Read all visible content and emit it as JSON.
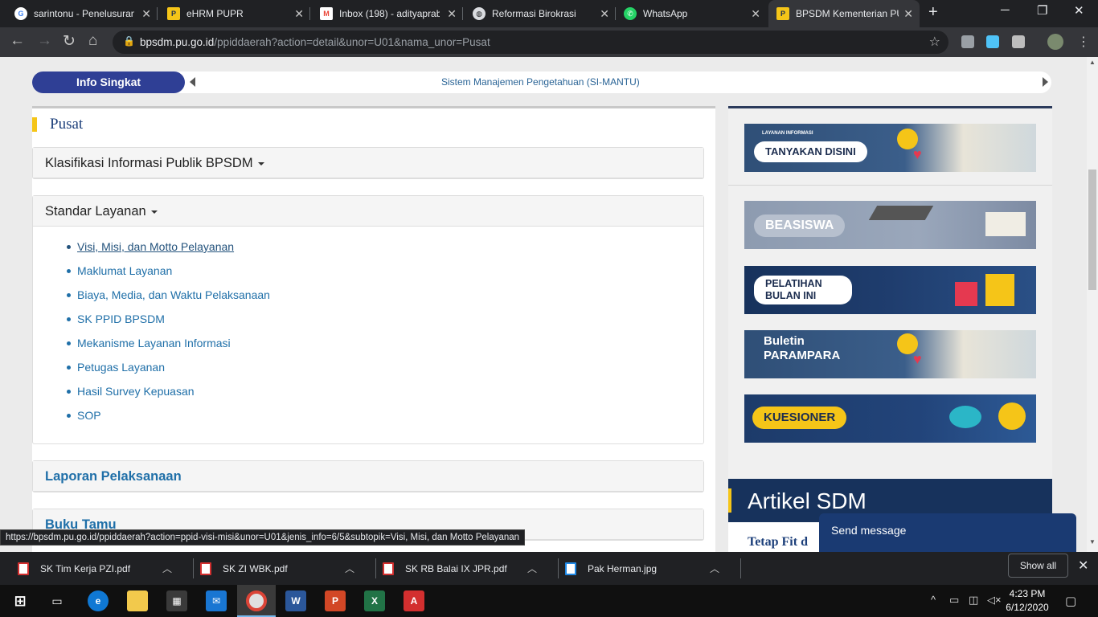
{
  "browser": {
    "tabs": [
      {
        "title": "sarintonu - Penelusuran",
        "favicon": "google-icon",
        "color": "#ffffff"
      },
      {
        "title": "eHRM PUPR",
        "favicon": "pupr-icon",
        "color": "#f5c518"
      },
      {
        "title": "Inbox (198) - adityaprab",
        "favicon": "gmail-icon",
        "color": "#ea4335"
      },
      {
        "title": "Reformasi Birokrasi",
        "favicon": "globe-icon",
        "color": "#dadce0"
      },
      {
        "title": "WhatsApp",
        "favicon": "whatsapp-icon",
        "color": "#25d366"
      },
      {
        "title": "BPSDM Kementerian PU",
        "favicon": "pupr-icon",
        "color": "#f5c518"
      }
    ],
    "url_host": "bpsdm.pu.go.id",
    "url_path": "/ppiddaerah?action=detail&unor=U01&nama_unor=Pusat"
  },
  "ticker": {
    "badge": "Info Singkat",
    "text": "Sistem Manajemen Pengetahuan (SI-MANTU)"
  },
  "main": {
    "section_title": "Pusat",
    "panels": {
      "klasifikasi": "Klasifikasi Informasi Publik BPSDM",
      "standar": "Standar Layanan",
      "standar_items": [
        "Visi, Misi, dan Motto Pelayanan",
        "Maklumat Layanan",
        "Biaya, Media, dan Waktu Pelaksanaan",
        "SK PPID BPSDM",
        "Mekanisme Layanan Informasi",
        "Petugas Layanan",
        "Hasil Survey Kepuasan",
        "SOP"
      ],
      "laporan": "Laporan Pelaksanaan",
      "bukutamu": "Buku Tamu"
    }
  },
  "sidebar": {
    "banners": [
      {
        "small": "LAYANAN INFORMASI",
        "label": "TANYAKAN DISINI",
        "bg": "#2f4f77",
        "pill_bg": "#ffffff",
        "pill_fg": "#1c2d4f"
      },
      {
        "small": "",
        "label": "BEASISWA",
        "bg": "#8d9bb0",
        "pill_bg": "#b7c0ce",
        "pill_fg": "#ffffff"
      },
      {
        "small": "",
        "label": "PELATIHAN BULAN INI",
        "bg": "#1f3d6e",
        "pill_bg": "#ffffff",
        "pill_fg": "#1c2d4f"
      },
      {
        "small": "",
        "label": "Buletin PARAMPARA",
        "bg": "#2f4f77",
        "pill_bg": "transparent",
        "pill_fg": "#ffffff"
      },
      {
        "small": "",
        "label": "KUESIONER",
        "bg": "#1d3b6a",
        "pill_bg": "#f5c518",
        "pill_fg": "#1c2d4f"
      }
    ],
    "artikel_title": "Artikel SDM",
    "artikel_sub": "Tetap Fit d"
  },
  "chat": {
    "label": "Send message"
  },
  "status_url": "https://bpsdm.pu.go.id/ppiddaerah?action=ppid-visi-misi&unor=U01&jenis_info=6/5&subtopik=Visi, Misi, dan Motto Pelayanan",
  "downloads": {
    "files": [
      {
        "name": "SK Tim Kerja PZI.pdf",
        "icon": "pdf-icon"
      },
      {
        "name": "SK ZI WBK.pdf",
        "icon": "pdf-icon"
      },
      {
        "name": "SK RB Balai IX JPR.pdf",
        "icon": "pdf-icon"
      },
      {
        "name": "Pak Herman.jpg",
        "icon": "image-file-icon"
      }
    ],
    "show_all": "Show all"
  },
  "taskbar": {
    "time": "4:23 PM",
    "date": "6/12/2020"
  }
}
